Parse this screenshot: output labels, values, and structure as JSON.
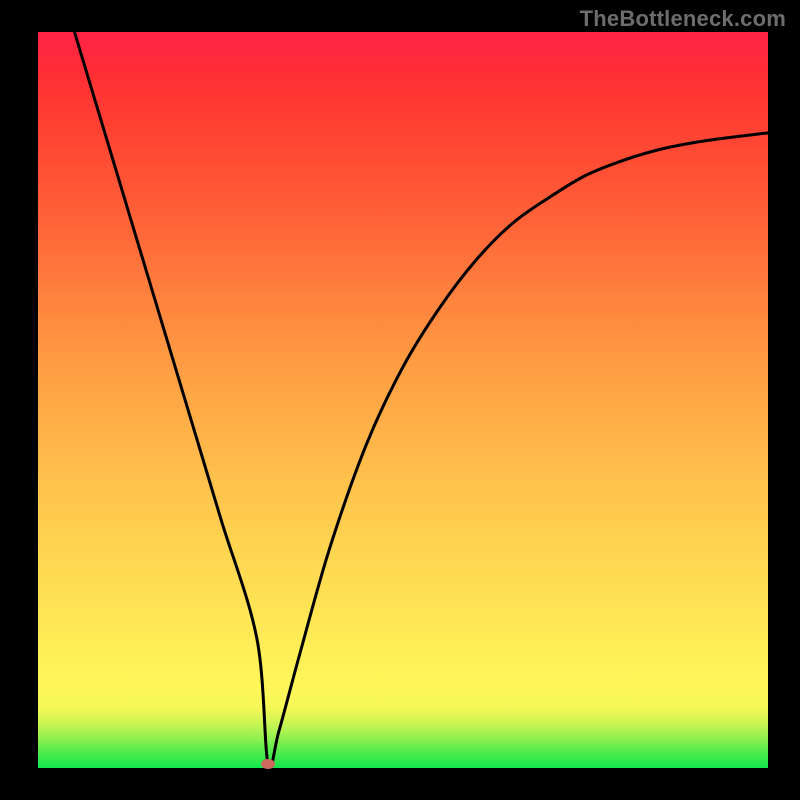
{
  "watermark": "TheBottleneck.com",
  "chart_data": {
    "type": "line",
    "title": "",
    "xlabel": "",
    "ylabel": "",
    "xlim": [
      0,
      100
    ],
    "ylim": [
      0,
      100
    ],
    "grid": false,
    "legend": null,
    "series": [
      {
        "name": "curve",
        "x": [
          5,
          10,
          15,
          20,
          25,
          30,
          31.5,
          33,
          36,
          40,
          45,
          50,
          55,
          60,
          65,
          70,
          75,
          80,
          85,
          90,
          95,
          100
        ],
        "values": [
          100,
          83.5,
          67.0,
          50.5,
          34.0,
          17.5,
          0.5,
          5.0,
          16.0,
          30.0,
          44.0,
          54.5,
          62.5,
          69.0,
          74.0,
          77.5,
          80.5,
          82.5,
          84.0,
          85.0,
          85.7,
          86.3
        ]
      }
    ],
    "marker": {
      "x": 31.5,
      "y": 0.5,
      "color": "#cc6a5f"
    },
    "background_gradient": {
      "type": "vertical",
      "stops": [
        {
          "pos": 0.0,
          "color": "#13e54e"
        },
        {
          "pos": 0.08,
          "color": "#f3f857"
        },
        {
          "pos": 0.5,
          "color": "#ff9c43"
        },
        {
          "pos": 1.0,
          "color": "#ff2347"
        }
      ]
    }
  },
  "colors": {
    "frame": "#000000",
    "curve": "#000000",
    "marker": "#cc6a5f",
    "watermark": "#6d6d6d"
  }
}
